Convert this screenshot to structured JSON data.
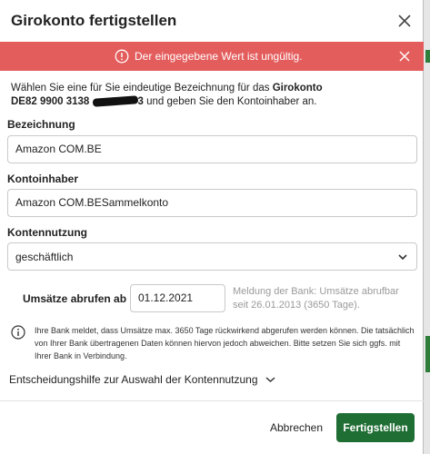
{
  "dialog": {
    "title": "Girokonto fertigstellen"
  },
  "alert": {
    "message": "Der eingegebene Wert ist ungültig.",
    "color": "#e45d5d"
  },
  "intro": {
    "text_before": "Wählen Sie eine für Sie eindeutige Bezeichnung für das ",
    "account_name": "Girokonto",
    "iban_visible_start": "DE82 9900 3138 ",
    "iban_visible_end": "3",
    "text_after": " und geben Sie den Kontoinhaber an."
  },
  "fields": {
    "bezeichnung_label": "Bezeichnung",
    "bezeichnung_value": "Amazon COM.BE",
    "kontoinhaber_label": "Kontoinhaber",
    "kontoinhaber_value": "Amazon COM.BESammelkonto",
    "kontennutzung_label": "Kontennutzung",
    "kontennutzung_value": "geschäftlich"
  },
  "umsaetze": {
    "label": "Umsätze abrufen ab",
    "date_value": "01.12.2021",
    "bank_note": "Meldung der Bank: Umsätze abrufbar seit 26.01.2013 (3650 Tage)."
  },
  "info": {
    "text": "Ihre Bank meldet, dass Umsätze max. 3650 Tage rückwirkend abgerufen werden können. Die tatsächlich von Ihrer Bank übertragenen Daten können hiervon jedoch abweichen. Bitte setzen Sie sich ggfs. mit Ihrer Bank in Verbindung."
  },
  "decision_help": {
    "label": "Entscheidungshilfe zur Auswahl der Kontennutzung"
  },
  "footer": {
    "cancel_label": "Abbrechen",
    "confirm_label": "Fertigstellen",
    "confirm_color": "#1f6e34"
  },
  "icons": {
    "close": "close-icon",
    "alert": "alert-circle-icon",
    "alert_close": "close-icon",
    "select_chevron": "chevron-down-icon",
    "info": "info-icon",
    "decision_chevron": "chevron-down-icon"
  }
}
